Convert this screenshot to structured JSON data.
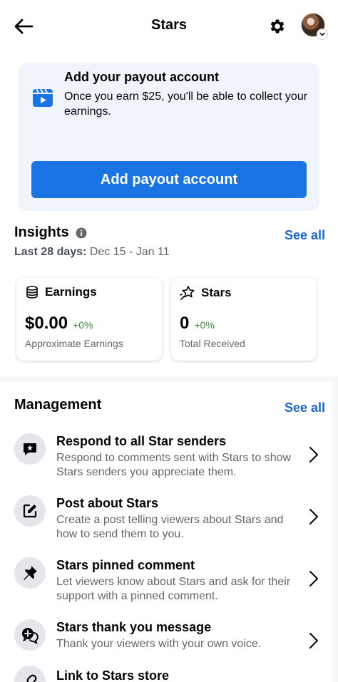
{
  "header": {
    "title": "Stars",
    "back_icon": "arrow-left-icon",
    "settings_icon": "gear-icon"
  },
  "payout": {
    "title": "Add your payout account",
    "description": "Once you earn $25, you'll be able to collect your earnings.",
    "button_label": "Add payout account",
    "icon": "video-clapper-icon"
  },
  "insights": {
    "title": "Insights",
    "see_all": "See all",
    "range_label": "Last 28 days:",
    "range_value": "Dec 15 - Jan 11",
    "cards": [
      {
        "title": "Earnings",
        "value": "$0.00",
        "delta": "+0%",
        "sub": "Approximate Earnings",
        "icon": "stack-of-coins-icon"
      },
      {
        "title": "Stars",
        "value": "0",
        "delta": "+0%",
        "sub": "Total Received",
        "icon": "star-sparkle-icon"
      }
    ]
  },
  "management": {
    "title": "Management",
    "see_all": "See all",
    "items": [
      {
        "label": "Respond to all Star senders",
        "description": "Respond to comments sent with Stars to show Stars senders you appreciate them.",
        "icon": "comment-star-icon"
      },
      {
        "label": "Post about Stars",
        "description": "Create a post telling viewers about Stars and how to send them to you.",
        "icon": "compose-icon"
      },
      {
        "label": "Stars pinned comment",
        "description": "Let viewers know about Stars and ask for their support with a pinned comment.",
        "icon": "pin-icon"
      },
      {
        "label": "Stars thank you message",
        "description": "Thank your viewers with your own voice.",
        "icon": "chat-bubbles-icon"
      },
      {
        "label": "Link to Stars store",
        "description": "",
        "icon": "store-link-icon"
      }
    ]
  },
  "colors": {
    "accent": "#1b74e4",
    "link": "#1a66d2",
    "positive": "#3a8f3e",
    "card_bg": "#f0f4fb"
  }
}
